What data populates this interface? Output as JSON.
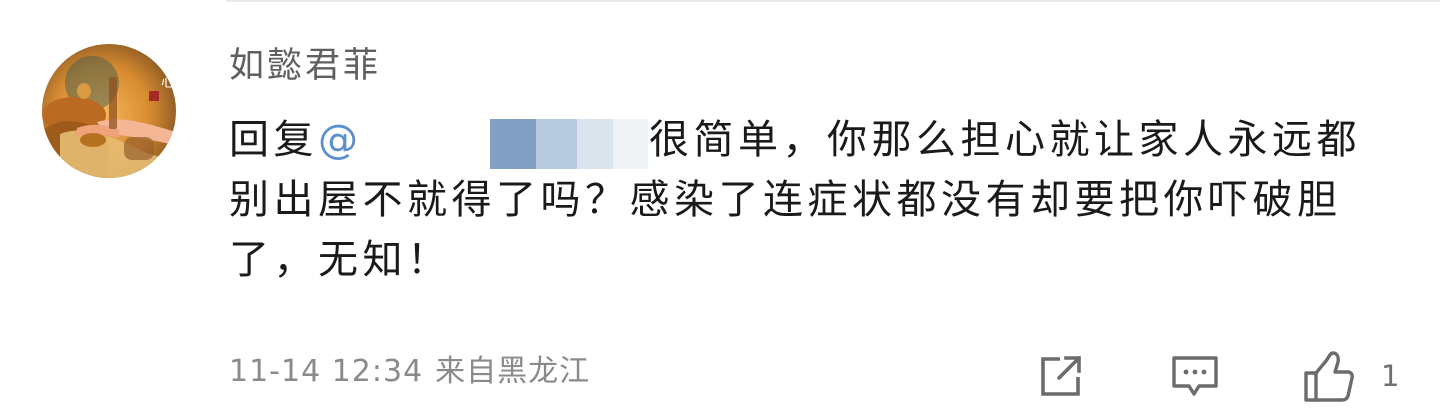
{
  "comment": {
    "username": "如懿君菲",
    "avatar_text": "禅心",
    "reply_prefix": "回复",
    "reply_mention_mark": "@",
    "text_after_redaction": "很简单，你那么担心就让家人永远都别出屋不就得了吗？感染了连症状都没有却要把你吓破胆了，无知！",
    "timestamp": "11-14 12:34",
    "source": "来自黑龙江",
    "like_count": "1"
  },
  "actions": {
    "share_icon": "share-icon",
    "comment_icon": "comment-icon",
    "like_icon": "like-icon"
  },
  "colors": {
    "username": "#5f5f5f",
    "text": "#1a1a1a",
    "meta": "#8a8a8a",
    "icons": "#6c6c6c"
  }
}
